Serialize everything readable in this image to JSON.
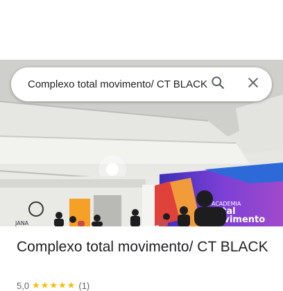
{
  "search": {
    "query": "Complexo total movimento/ CT BLACK",
    "search_icon": "search-icon",
    "close_icon": "close-icon"
  },
  "photo": {
    "wall_logo_line1": "ACADEMIA",
    "wall_logo_line2": "total",
    "wall_logo_line3": "movimento",
    "left_sign_text": "JANA"
  },
  "place": {
    "title": "Complexo total movimento/ CT BLACK",
    "rating": "5,0",
    "stars": "★★★★★",
    "review_count": "(1)"
  },
  "colors": {
    "star": "#fbbc04",
    "text_primary": "#202124",
    "text_secondary": "#5f6368",
    "wall_purple": "#6a3fd0"
  }
}
